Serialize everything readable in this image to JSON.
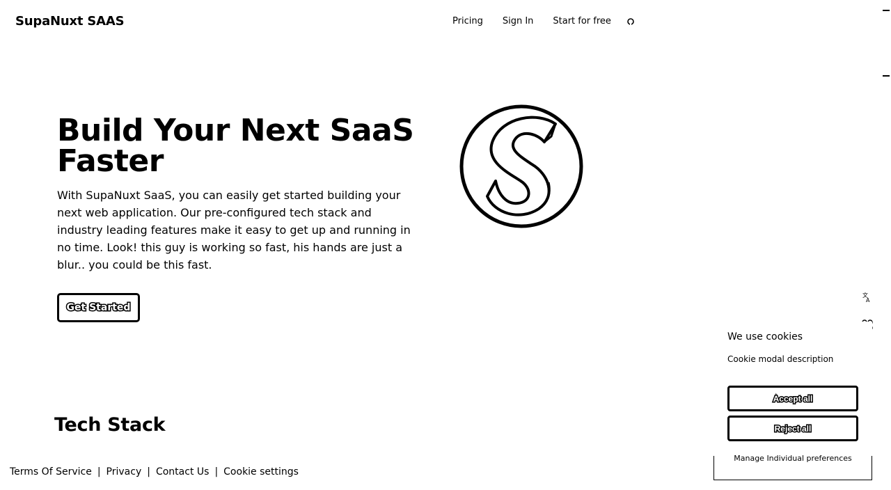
{
  "header": {
    "brand": "SupaNuxt SAAS",
    "nav": {
      "pricing": "Pricing",
      "sign_in": "Sign In",
      "start_free": "Start for free",
      "github_icon": "github-icon"
    }
  },
  "hero": {
    "title": "Build Your Next SaaS Faster",
    "description": "With SupaNuxt SaaS, you can easily get started building your next web application. Our pre-configured tech stack and industry leading features make it easy to get up and running in no time. Look! this guy is working so fast, his hands are just a blur.. you could be this fast.",
    "cta_label": "Get Started",
    "logo_icon": "supanuxt-s-logo"
  },
  "sections": {
    "tech_stack_title": "Tech Stack"
  },
  "footer": {
    "links": [
      "Terms Of Service",
      "Privacy",
      "Contact Us",
      "Cookie settings"
    ],
    "separator": "|"
  },
  "side_icons": [
    "translate-icon",
    "grid-icon",
    "face-icon"
  ],
  "cookie_modal": {
    "title": "We use cookies",
    "description": "Cookie modal description",
    "accept_label": "Accept all",
    "reject_label": "Reject all",
    "manage_label": "Manage Individual preferences"
  }
}
